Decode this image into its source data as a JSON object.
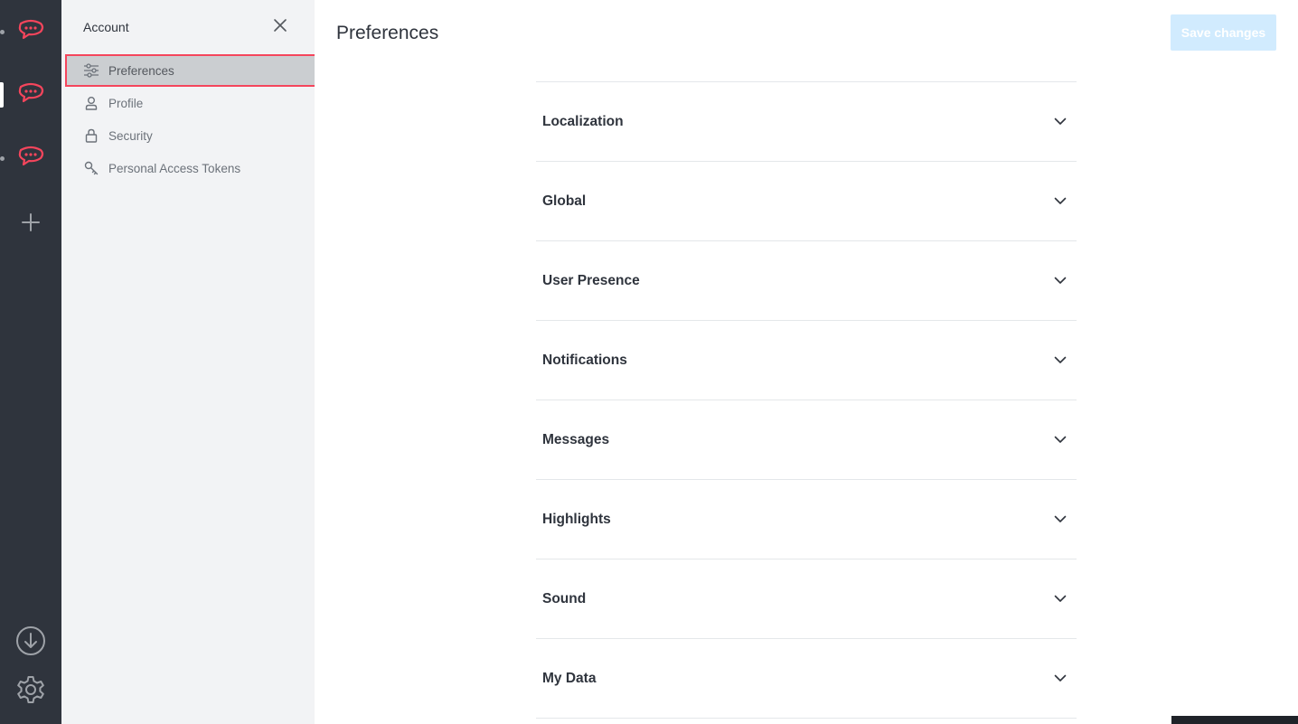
{
  "sidebar": {
    "title": "Account",
    "items": [
      {
        "label": "Preferences",
        "icon": "sliders-icon",
        "active": true
      },
      {
        "label": "Profile",
        "icon": "user-icon",
        "active": false
      },
      {
        "label": "Security",
        "icon": "lock-icon",
        "active": false
      },
      {
        "label": "Personal Access Tokens",
        "icon": "key-icon",
        "active": false
      }
    ]
  },
  "main": {
    "title": "Preferences",
    "save_label": "Save changes",
    "sections": [
      "Localization",
      "Global",
      "User Presence",
      "Notifications",
      "Messages",
      "Highlights",
      "Sound",
      "My Data"
    ]
  },
  "colors": {
    "rail": "#2f343d",
    "brand": "#f5455c",
    "sidebar": "#f2f3f5",
    "save_button_disabled": "#d1ebfe"
  }
}
